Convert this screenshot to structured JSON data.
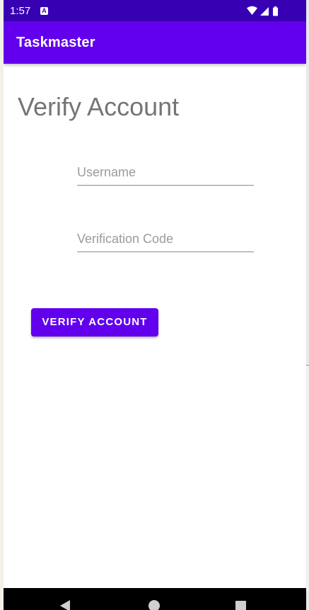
{
  "status_bar": {
    "time": "1:57",
    "notification_icon": "A"
  },
  "app_bar": {
    "title": "Taskmaster"
  },
  "page": {
    "title": "Verify Account"
  },
  "form": {
    "username": {
      "value": "",
      "placeholder": "Username"
    },
    "verification_code": {
      "value": "",
      "placeholder": "Verification Code"
    },
    "submit_label": "VERIFY ACCOUNT"
  },
  "colors": {
    "status_bar": "#3700b3",
    "primary": "#6200ee",
    "title_text": "#757575"
  },
  "icons": {
    "status": [
      "notification-icon",
      "wifi-icon",
      "cell-signal-icon",
      "battery-icon"
    ],
    "navigation": [
      "back-icon",
      "home-icon",
      "recents-icon"
    ]
  }
}
